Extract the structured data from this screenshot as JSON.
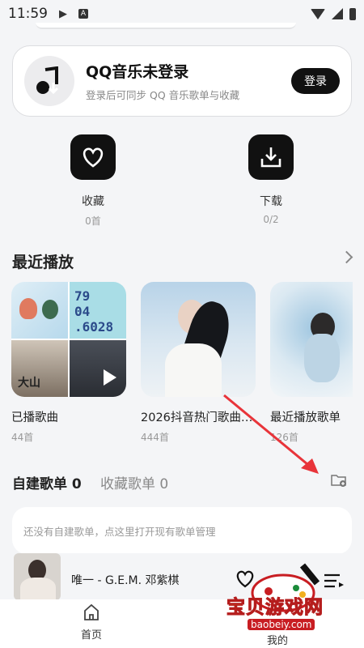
{
  "status_bar": {
    "time": "11:59"
  },
  "login_card": {
    "title": "QQ音乐未登录",
    "subtitle": "登录后可同步 QQ 音乐歌单与收藏",
    "login_button": "登录"
  },
  "quick_actions": [
    {
      "label": "收藏",
      "count": "0首",
      "icon": "heart-icon"
    },
    {
      "label": "下载",
      "count": "0/2",
      "icon": "download-icon"
    }
  ],
  "recent": {
    "title": "最近播放",
    "cards": [
      {
        "title": "已播歌曲",
        "count": "44首"
      },
      {
        "title": "2026抖音热门歌曲…",
        "count": "444首"
      },
      {
        "title": "最近播放歌单",
        "count": "126首"
      }
    ]
  },
  "tabs": {
    "self_built": "自建歌单 0",
    "favorited": "收藏歌单 0"
  },
  "empty_message": "还没有自建歌单，点这里打开现有歌单管理",
  "player": {
    "track": "唯一 - G.E.M. 邓紫棋"
  },
  "bottom_nav": {
    "home": "首页",
    "mine": "我的"
  },
  "watermark": {
    "text": "宝贝游戏网",
    "url": "baobeiy.com"
  },
  "colors": {
    "accent_dark": "#111111",
    "background": "#f4f5f7",
    "annotation_arrow": "#e8343a"
  }
}
